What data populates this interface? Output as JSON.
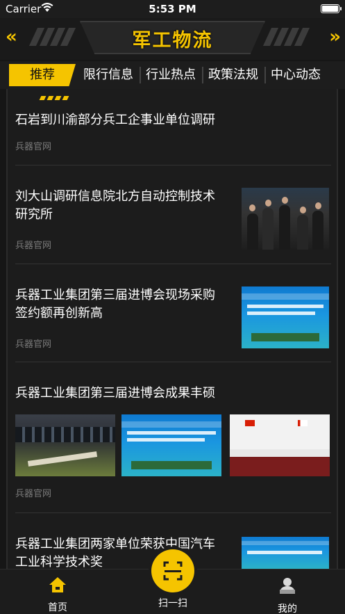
{
  "status_bar": {
    "carrier": "Carrier",
    "time": "5:53 PM"
  },
  "header": {
    "title": "军工物流",
    "back_glyph": "«",
    "forward_glyph": "»"
  },
  "tabs": [
    {
      "label": "推荐",
      "active": true
    },
    {
      "label": "限行信息",
      "active": false
    },
    {
      "label": "行业热点",
      "active": false
    },
    {
      "label": "政策法规",
      "active": false
    },
    {
      "label": "中心动态",
      "active": false
    }
  ],
  "news": [
    {
      "headline": "石岩到川渝部分兵工企事业单位调研",
      "source": "兵器官网"
    },
    {
      "headline": "刘大山调研信息院北方自动控制技术研究所",
      "source": "兵器官网",
      "thumbnail": "meeting-photo"
    },
    {
      "headline": "兵器工业集团第三届进博会现场采购签约额再创新高",
      "source": "兵器官网",
      "thumbnail": "expo-signing-photo"
    },
    {
      "headline": "兵器工业集团第三届进博会成果丰硕",
      "source": "兵器官网",
      "thumbnails": [
        "exhibition-model-photo",
        "expo-signing-photo",
        "signing-ceremony-photo"
      ]
    },
    {
      "headline": "兵器工业集团两家单位荣获中国汽车工业科学技术奖",
      "source": "兵器官网",
      "thumbnail": "award-banner-photo"
    }
  ],
  "bottom_nav": [
    {
      "label": "首页",
      "icon": "home-icon"
    },
    {
      "label": "扫一扫",
      "icon": "scan-icon"
    },
    {
      "label": "我的",
      "icon": "user-icon"
    }
  ],
  "colors": {
    "accent": "#f5c400",
    "background": "#161616",
    "text_muted": "#7a7a7a"
  }
}
